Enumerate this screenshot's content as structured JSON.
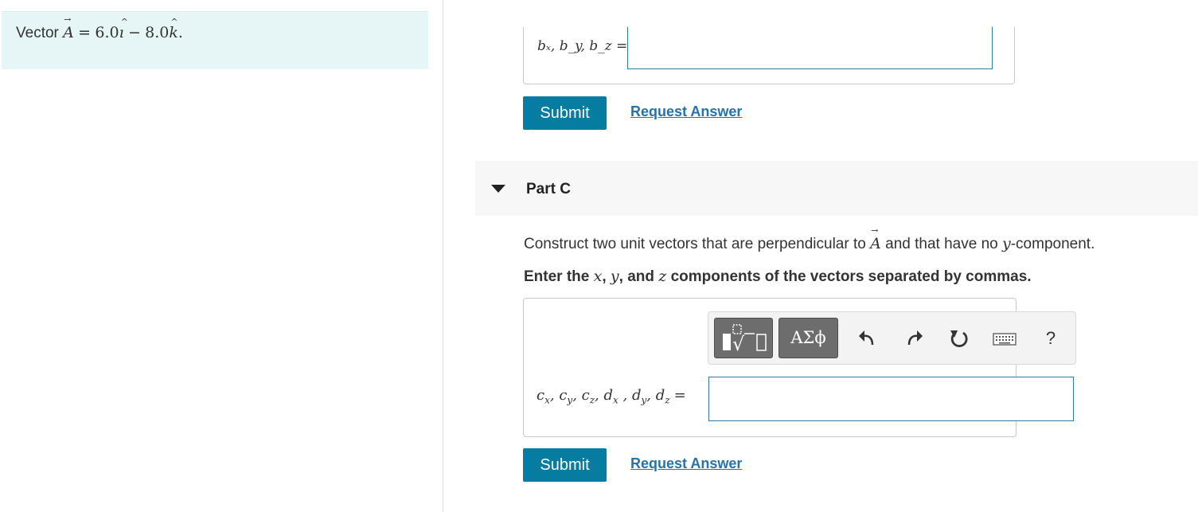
{
  "left": {
    "vector_word": "Vector",
    "vector_symbol": "A",
    "equals": "=",
    "coef_i": "6.0",
    "unit_i": "ı",
    "minus": "−",
    "coef_k": "8.0",
    "unit_k": "k",
    "period": "."
  },
  "part_b": {
    "label": "bₓ, b_y, b_z =",
    "input_value": "",
    "submit_label": "Submit",
    "request_label": "Request Answer"
  },
  "part_c": {
    "title": "Part C",
    "prompt_pre": "Construct two unit vectors that are perpendicular to",
    "prompt_vec": "A",
    "prompt_mid": "and that have no",
    "prompt_y": "y",
    "prompt_post": "-component.",
    "instr_pre": "Enter the",
    "instr_x": "x",
    "instr_sep": ",",
    "instr_y": "y",
    "instr_and": ", and",
    "instr_z": "z",
    "instr_post": "components of the vectors separated by commas.",
    "input_value": "",
    "submit_label": "Submit",
    "request_label": "Request Answer"
  },
  "toolbar": {
    "greek_label": "ΑΣϕ",
    "help_label": "?"
  },
  "icons": {
    "caret": "caret-down-icon",
    "templates": "math-templates-icon",
    "undo": "undo-icon",
    "redo": "redo-icon",
    "reset": "reset-icon",
    "keyboard": "keyboard-icon"
  },
  "colors": {
    "accent": "#077ca1",
    "link": "#2574a9",
    "problem_bg": "#e6f5f5",
    "part_header_bg": "#f7f7f7"
  }
}
